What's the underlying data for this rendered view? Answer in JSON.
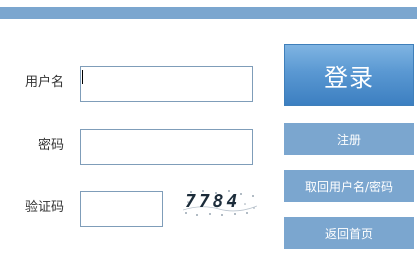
{
  "form": {
    "username_label": "用户名",
    "password_label": "密码",
    "captcha_label": "验证码",
    "username_value": "",
    "password_value": "",
    "captcha_value": "",
    "captcha_image_text": "7784"
  },
  "buttons": {
    "login": "登录",
    "register": "注册",
    "retrieve": "取回用户名/密码",
    "home": "返回首页"
  },
  "colors": {
    "accent": "#7ba6cf",
    "login_button": "#5a98d2"
  }
}
